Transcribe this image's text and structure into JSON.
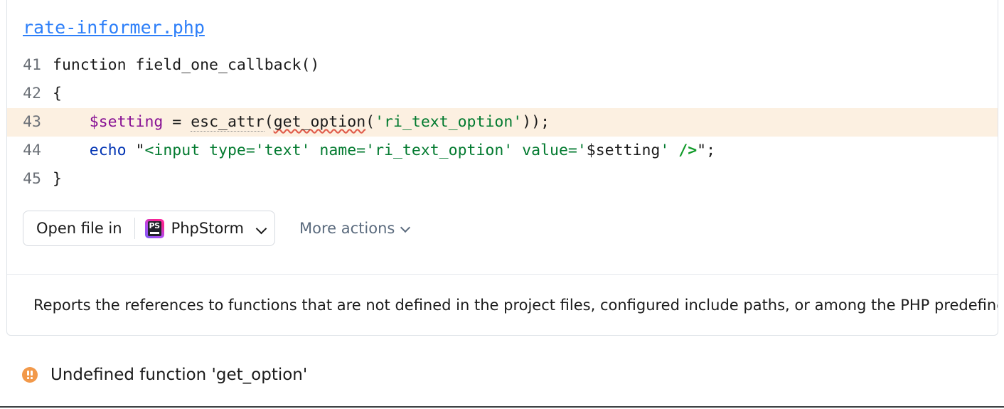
{
  "panel": {
    "file_name": "rate-informer.php",
    "code": {
      "lines": [
        {
          "number": "41",
          "highlight": false,
          "tokens": [
            {
              "text": "function field_one_callback()",
              "style": "plain"
            }
          ]
        },
        {
          "number": "42",
          "highlight": false,
          "tokens": [
            {
              "text": "{",
              "style": "plain"
            }
          ]
        },
        {
          "number": "43",
          "highlight": true,
          "tokens": [
            {
              "text": "    ",
              "style": "plain"
            },
            {
              "text": "$setting",
              "style": "var"
            },
            {
              "text": " = ",
              "style": "plain"
            },
            {
              "text": "esc_attr",
              "style": "dotted"
            },
            {
              "text": "(",
              "style": "plain"
            },
            {
              "text": "get_option",
              "style": "squiggle"
            },
            {
              "text": "(",
              "style": "plain"
            },
            {
              "text": "'ri_text_option'",
              "style": "string"
            },
            {
              "text": "));",
              "style": "plain"
            }
          ]
        },
        {
          "number": "44",
          "highlight": false,
          "tokens": [
            {
              "text": "    ",
              "style": "plain"
            },
            {
              "text": "echo",
              "style": "keyword"
            },
            {
              "text": " ",
              "style": "plain"
            },
            {
              "text": "\"",
              "style": "plain"
            },
            {
              "text": "<input type='text' name='ri_text_option' value='",
              "style": "string"
            },
            {
              "text": "$setting",
              "style": "plain"
            },
            {
              "text": "' ",
              "style": "string"
            },
            {
              "text": "/>",
              "style": "tag"
            },
            {
              "text": "\";",
              "style": "plain"
            }
          ]
        },
        {
          "number": "45",
          "highlight": false,
          "tokens": [
            {
              "text": "}",
              "style": "plain"
            }
          ]
        }
      ]
    },
    "actions": {
      "open_file_in_label": "Open file in",
      "app_name": "PhpStorm",
      "app_icon": "phpstorm-icon",
      "app_icon_text": "PS",
      "dropdown_icon": "chevron-down-icon",
      "more_actions_label": "More actions",
      "more_actions_icon": "chevron-down-icon"
    },
    "description": "Reports the references to functions that are not defined in the project files, configured include paths, or among the PHP predefined functions."
  },
  "warning": {
    "icon": "double-exclamation-warning-icon",
    "message": "Undefined function 'get_option'"
  },
  "colors": {
    "link": "#2d7ff9",
    "highlight_row": "#fcf0e1",
    "string": "#027a2f",
    "keyword": "#0033b3",
    "variable": "#871094",
    "tag": "#0f9a28",
    "warning": "#f2994a",
    "border": "#dfe3e8"
  }
}
